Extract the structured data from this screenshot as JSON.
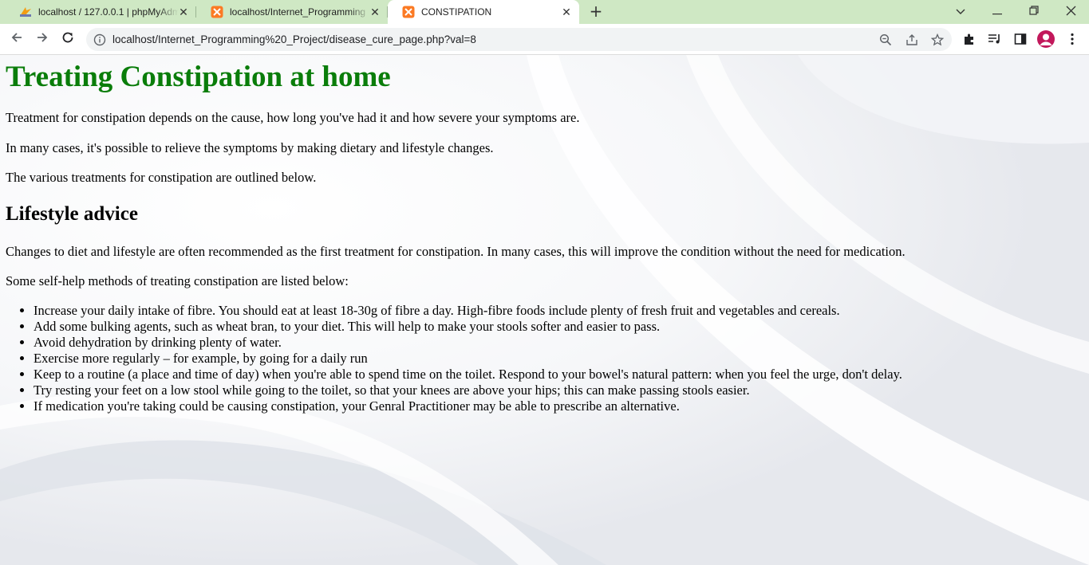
{
  "browser": {
    "tabs": [
      {
        "title": "localhost / 127.0.0.1 | phpMyAdmin",
        "icon": "phpmyadmin-icon"
      },
      {
        "title": "localhost/Internet_Programming",
        "icon": "xampp-icon"
      },
      {
        "title": "CONSTIPATION",
        "icon": "xampp-icon",
        "active": true
      }
    ],
    "url": "localhost/Internet_Programming%20_Project/disease_cure_page.php?val=8"
  },
  "page": {
    "heading": "Treating Constipation at home",
    "intro": [
      "Treatment for constipation depends on the cause, how long you've had it and how severe your symptoms are.",
      "In many cases, it's possible to relieve the symptoms by making dietary and lifestyle changes.",
      "The various treatments for constipation are outlined below."
    ],
    "subheading": "Lifestyle advice",
    "body": [
      "Changes to diet and lifestyle are often recommended as the first treatment for constipation. In many cases, this will improve the condition without the need for medication.",
      "Some self-help methods of treating constipation are listed below:"
    ],
    "tips": [
      "Increase your daily intake of fibre. You should eat at least 18-30g of fibre a day. High-fibre foods include plenty of fresh fruit and vegetables and cereals.",
      "Add some bulking agents, such as wheat bran, to your diet. This will help to make your stools softer and easier to pass.",
      "Avoid dehydration by drinking plenty of water.",
      "Exercise more regularly – for example, by going for a daily run",
      "Keep to a routine (a place and time of day) when you're able to spend time on the toilet. Respond to your bowel's natural pattern: when you feel the urge, don't delay.",
      "Try resting your feet on a low stool while going to the toilet, so that your knees are above your hips; this can make passing stools easier.",
      "If medication you're taking could be causing constipation, your Genral Practitioner may be able to prescribe an alternative."
    ]
  },
  "colors": {
    "heading": "#0a7d0a",
    "tabstrip": "#cfe8c4",
    "avatar": "#c2185b"
  }
}
